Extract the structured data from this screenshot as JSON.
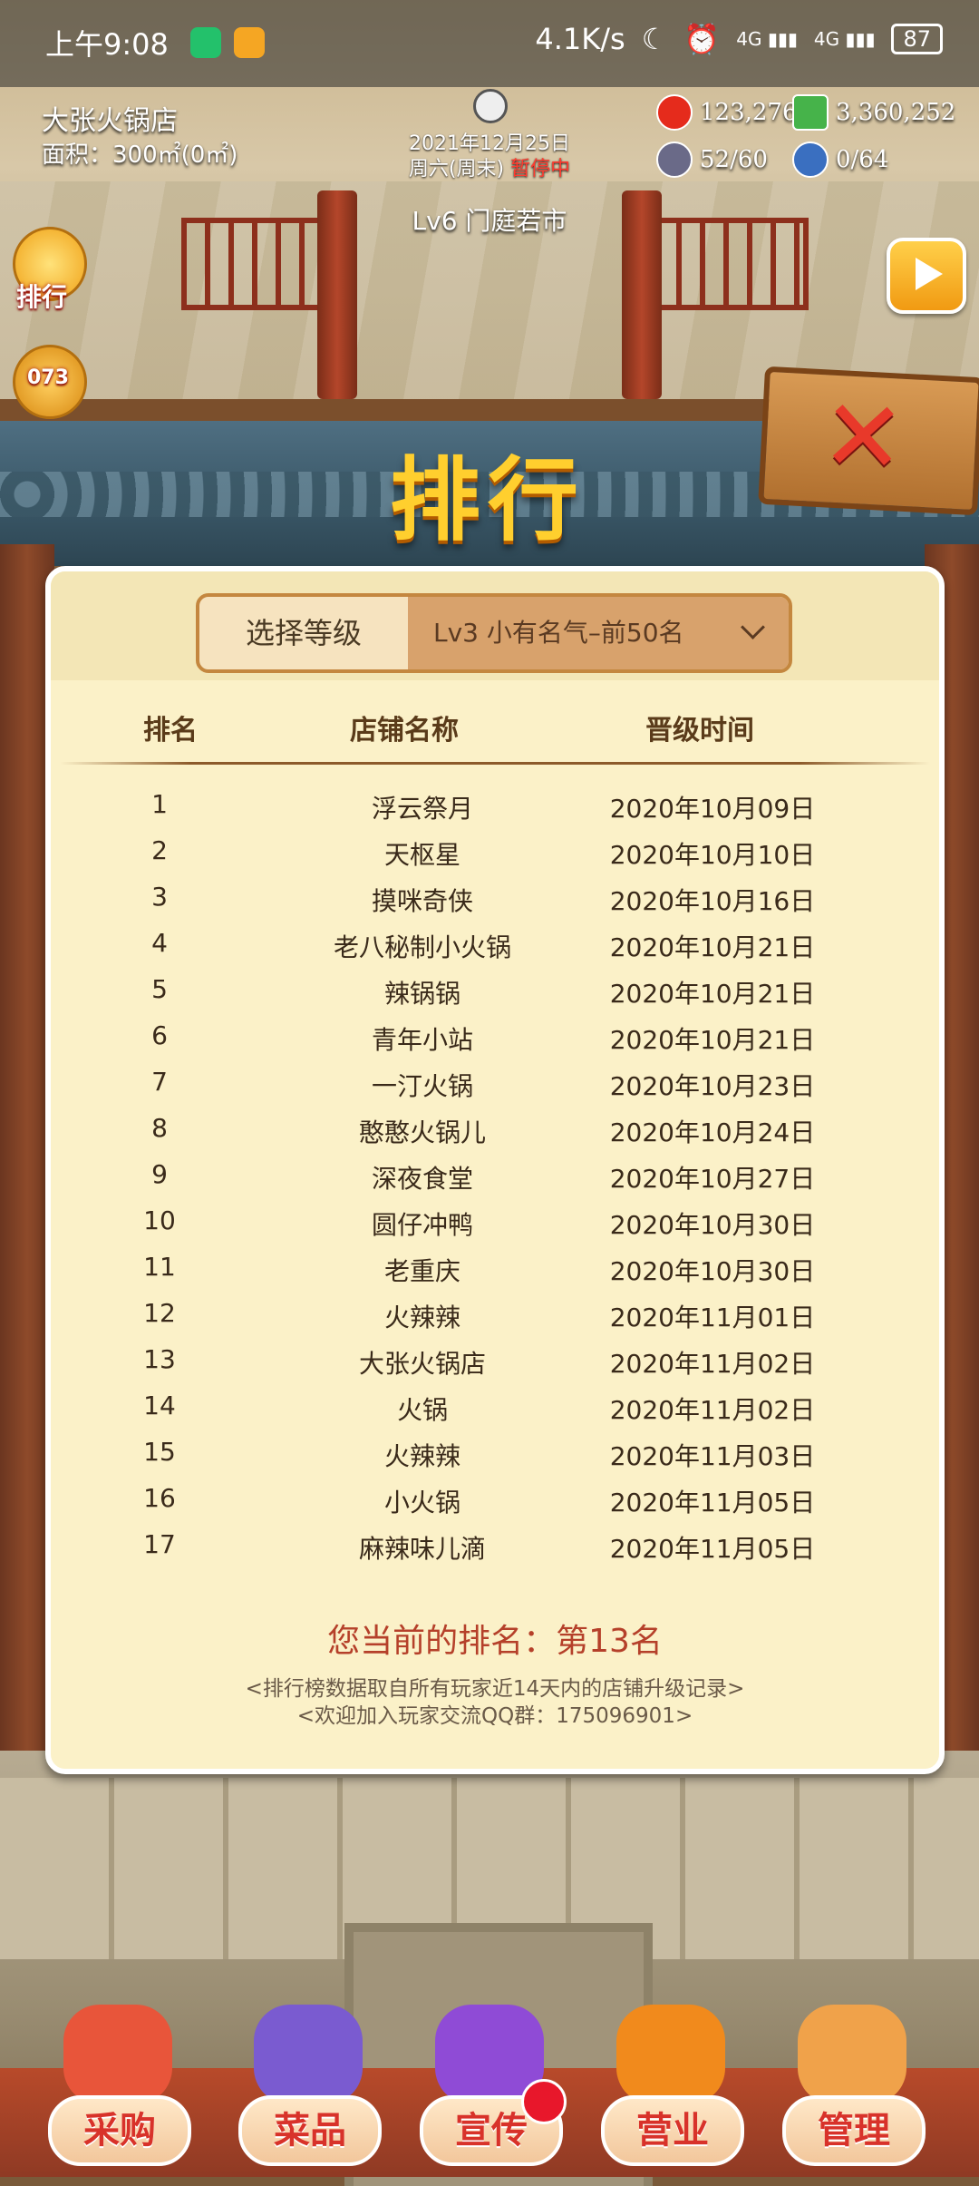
{
  "status_bar": {
    "time": "上午9:08",
    "network_speed": "4.1K/s",
    "signal1": "4G",
    "signal2": "4G",
    "battery": "87"
  },
  "hud": {
    "shop_name": "大张火锅店",
    "area": "面积：300㎡(0㎡)",
    "date": "2021年12月25日",
    "weekday": "周六(周末)",
    "paused": "暂停中",
    "level": "Lv6 门庭若市",
    "tomato": "123,276",
    "cash": "3,360,252",
    "car": "52/60",
    "staff": "0/64",
    "rank_button": "排行",
    "timer": "073"
  },
  "title": "排行",
  "selector": {
    "label": "选择等级",
    "value": "Lv3 小有名气–前50名"
  },
  "table": {
    "headers": {
      "rank": "排名",
      "name": "店铺名称",
      "time": "晋级时间"
    },
    "rows": [
      {
        "rank": "1",
        "name": "浮云祭月",
        "time": "2020年10月09日"
      },
      {
        "rank": "2",
        "name": "天枢星",
        "time": "2020年10月10日"
      },
      {
        "rank": "3",
        "name": "摸咪奇侠",
        "time": "2020年10月16日"
      },
      {
        "rank": "4",
        "name": "老八秘制小火锅",
        "time": "2020年10月21日"
      },
      {
        "rank": "5",
        "name": "辣锅锅",
        "time": "2020年10月21日"
      },
      {
        "rank": "6",
        "name": "青年小站",
        "time": "2020年10月21日"
      },
      {
        "rank": "7",
        "name": "一汀火锅",
        "time": "2020年10月23日"
      },
      {
        "rank": "8",
        "name": "憨憨火锅儿",
        "time": "2020年10月24日"
      },
      {
        "rank": "9",
        "name": "深夜食堂",
        "time": "2020年10月27日"
      },
      {
        "rank": "10",
        "name": "圆仔冲鸭",
        "time": "2020年10月30日"
      },
      {
        "rank": "11",
        "name": "老重庆",
        "time": "2020年10月30日"
      },
      {
        "rank": "12",
        "name": "火辣辣",
        "time": "2020年11月01日"
      },
      {
        "rank": "13",
        "name": "大张火锅店",
        "time": "2020年11月02日"
      },
      {
        "rank": "14",
        "name": "火锅",
        "time": "2020年11月02日"
      },
      {
        "rank": "15",
        "name": "火辣辣",
        "time": "2020年11月03日"
      },
      {
        "rank": "16",
        "name": "小火锅",
        "time": "2020年11月05日"
      },
      {
        "rank": "17",
        "name": "麻辣味儿滴",
        "time": "2020年11月05日"
      }
    ]
  },
  "my_rank": "您当前的排名：第13名",
  "note1": "<排行榜数据取自所有玩家近14天内的店铺升级记录>",
  "note2": "<欢迎加入玩家交流QQ群：175096901>",
  "nav": [
    {
      "label": "采购",
      "icon": "shop-icon",
      "color": "#e8553a"
    },
    {
      "label": "菜品",
      "icon": "dish-icon",
      "color": "#7a5bd0"
    },
    {
      "label": "宣传",
      "icon": "video-icon",
      "color": "#8f4bd6"
    },
    {
      "label": "营业",
      "icon": "cloche-icon",
      "color": "#f18a1c"
    },
    {
      "label": "管理",
      "icon": "manager-icon",
      "color": "#f0a24a"
    }
  ]
}
